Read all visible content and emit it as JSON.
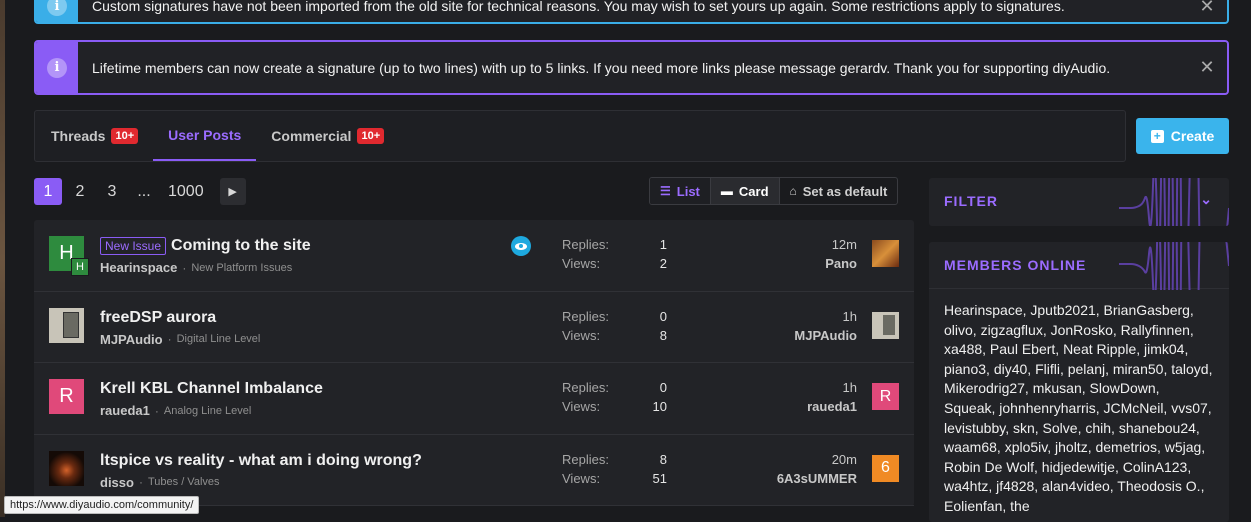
{
  "notices": {
    "blue_text": "Custom signatures have not been imported from the old site for technical reasons. You may wish to set yours up again. Some restrictions apply to signatures.",
    "purple_text": "Lifetime members can now create a signature (up to two lines) with up to 5 links. If you need more links please message gerardv. Thank you for supporting diyAudio.",
    "info_glyph": "i",
    "close_glyph": "✕"
  },
  "tabs": [
    {
      "label": "Threads",
      "badge": "10+"
    },
    {
      "label": "User Posts",
      "badge": ""
    },
    {
      "label": "Commercial",
      "badge": "10+"
    }
  ],
  "create_label": "Create",
  "pagination": {
    "pages": [
      "1",
      "2",
      "3",
      "...",
      "1000"
    ],
    "current": "1",
    "next_glyph": "▶"
  },
  "view": {
    "list_label": "List",
    "card_label": "Card",
    "default_label": "Set as default",
    "active": "List"
  },
  "threads": [
    {
      "title": "Coming to the site",
      "prefix": "New Issue",
      "author": "Hearinspace",
      "forum": "New Platform Issues",
      "replies_label": "Replies:",
      "replies": "1",
      "views_label": "Views:",
      "views": "2",
      "time": "12m",
      "last_user": "Pano",
      "avatar_letter": "H",
      "avatar_color": "#2e8b3e",
      "watched": true
    },
    {
      "title": "freeDSP aurora",
      "prefix": "",
      "author": "MJPAudio",
      "forum": "Digital Line Level",
      "replies_label": "Replies:",
      "replies": "0",
      "views_label": "Views:",
      "views": "8",
      "time": "1h",
      "last_user": "MJPAudio",
      "avatar_letter": "",
      "avatar_color": "#8a8a80",
      "watched": false
    },
    {
      "title": "Krell KBL Channel Imbalance",
      "prefix": "",
      "author": "raueda1",
      "forum": "Analog Line Level",
      "replies_label": "Replies:",
      "replies": "0",
      "views_label": "Views:",
      "views": "10",
      "time": "1h",
      "last_user": "raueda1",
      "avatar_letter": "R",
      "avatar_color": "#e0497a",
      "watched": false
    },
    {
      "title": "ltspice vs reality - what am i doing wrong?",
      "prefix": "",
      "author": "disso",
      "forum": "Tubes / Valves",
      "replies_label": "Replies:",
      "replies": "8",
      "views_label": "Views:",
      "views": "51",
      "time": "20m",
      "last_user": "6A3sUMMER",
      "avatar_letter": "",
      "avatar_color": "#2a1a12",
      "watched": false,
      "last_avatar_letter": "6",
      "last_avatar_color": "#f08a24"
    }
  ],
  "sidebar": {
    "filter_label": "FILTER",
    "members_label": "MEMBERS ONLINE",
    "members_text": "Hearinspace, Jputb2021, BrianGasberg, olivo, zigzagflux, JonRosko, Rallyfinnen, xa488, Paul Ebert, Neat Ripple, jimk04, piano3, diy40, Flifli, pelanj, miran50, taloyd, Mikerodrig27, mkusan, SlowDown, Squeak, johnhenryharris, JCMcNeil, vvs07, levistubby, skn, Solve, chih, shanebou24, waam68, xplo5iv, jholtz, demetrios, w5jag, Robin De Wolf, hidjedewitje, ColinA123, wa4htz, jf4828, alan4video, Theodosis O., Eolienfan, the"
  },
  "status_url": "https://www.diyaudio.com/community/",
  "colors": {
    "accent": "#8a5cf5",
    "info": "#3aaee8",
    "badge": "#e0292f"
  }
}
